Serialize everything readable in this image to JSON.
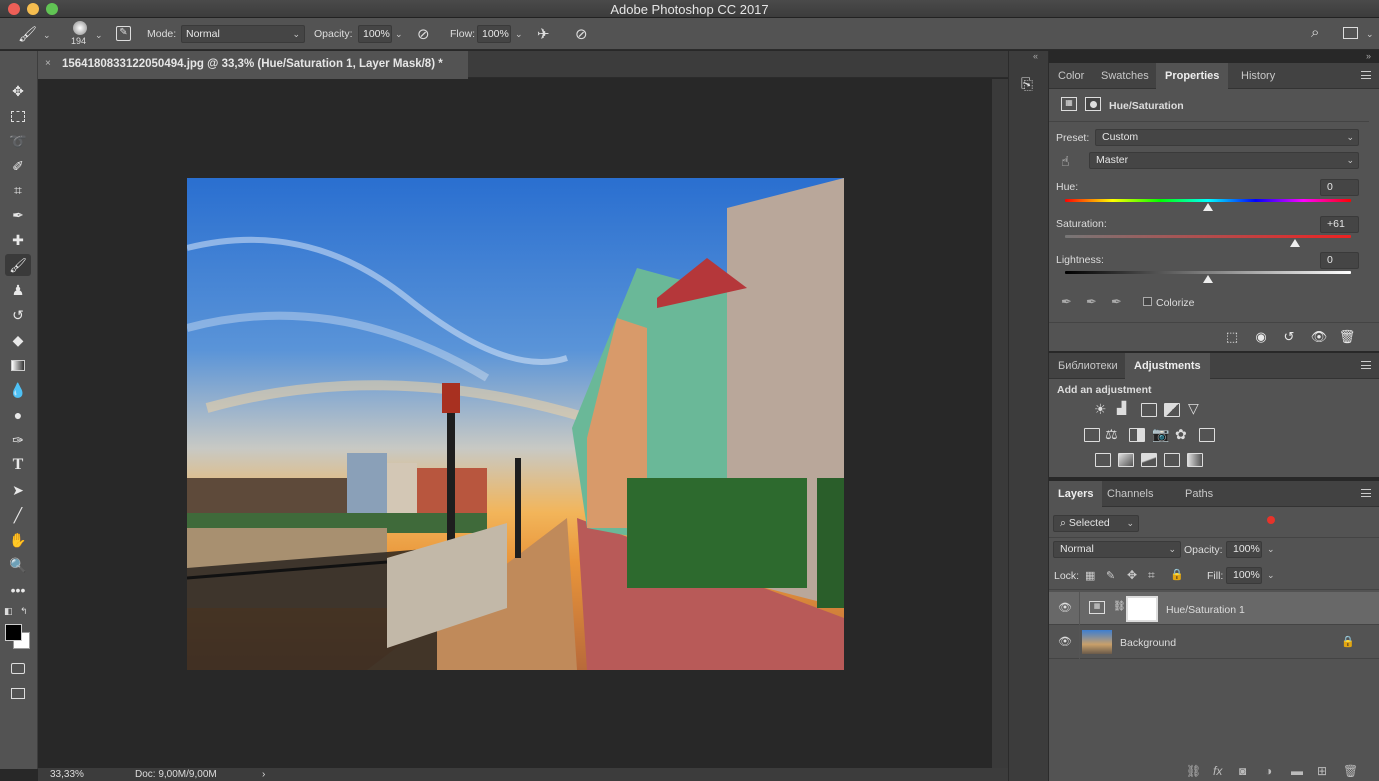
{
  "app": {
    "title": "Adobe Photoshop CC 2017"
  },
  "options_bar": {
    "brush_size": "194",
    "mode_label": "Mode:",
    "mode_value": "Normal",
    "opacity_label": "Opacity:",
    "opacity_value": "100%",
    "flow_label": "Flow:",
    "flow_value": "100%"
  },
  "document": {
    "tab_title": "1564180833122050494.jpg @ 33,3% (Hue/Saturation 1, Layer Mask/8) *",
    "close_glyph": "×"
  },
  "status": {
    "zoom": "33,33%",
    "doc": "Doc: 9,00M/9,00M",
    "arrow": "›"
  },
  "properties_panel": {
    "tabs": [
      "Color",
      "Swatches",
      "Properties",
      "History"
    ],
    "active_tab": "Properties",
    "header": "Hue/Saturation",
    "preset_label": "Preset:",
    "preset_value": "Custom",
    "range_value": "Master",
    "hue_label": "Hue:",
    "hue_value": "0",
    "saturation_label": "Saturation:",
    "saturation_value": "+61",
    "lightness_label": "Lightness:",
    "lightness_value": "0",
    "colorize_label": "Colorize",
    "slider_levels": {
      "hue": 0,
      "saturation": 61,
      "lightness": 0
    }
  },
  "adjustments_panel": {
    "tabs": [
      "Библиотеки",
      "Adjustments"
    ],
    "active_tab": "Adjustments",
    "heading": "Add an adjustment",
    "row1": [
      "brightness-contrast-icon",
      "levels-icon",
      "curves-icon",
      "exposure-icon",
      "vibrance-icon"
    ],
    "row2": [
      "hue-saturation-icon",
      "color-balance-icon",
      "black-white-icon",
      "photo-filter-icon",
      "channel-mixer-icon",
      "color-lookup-icon"
    ],
    "row3": [
      "invert-icon",
      "posterize-icon",
      "threshold-icon",
      "selective-color-icon",
      "gradient-map-icon"
    ]
  },
  "layers_panel": {
    "tabs": [
      "Layers",
      "Channels",
      "Paths"
    ],
    "active_tab": "Layers",
    "filter_value": "Selected",
    "blend_mode": "Normal",
    "opacity_label": "Opacity:",
    "opacity_value": "100%",
    "lock_label": "Lock:",
    "fill_label": "Fill:",
    "fill_value": "100%",
    "layers": [
      {
        "name": "Hue/Saturation 1",
        "selected": true
      },
      {
        "name": "Background",
        "selected": false
      }
    ]
  },
  "colors": {
    "panel_bg": "#535353",
    "canvas_bg": "#282828",
    "selected_layer": "#686868"
  }
}
